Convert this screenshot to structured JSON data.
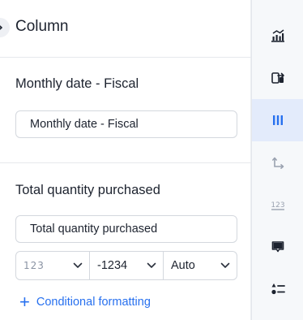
{
  "header": {
    "title": "Column"
  },
  "sections": [
    {
      "title": "Monthly date - Fiscal",
      "input_value": "Monthly date - Fiscal"
    },
    {
      "title": "Total quantity purchased",
      "input_value": "Total quantity purchased"
    }
  ],
  "format": {
    "number_format": "123",
    "negative_format": "-1234",
    "units": "Auto"
  },
  "conditional_link": {
    "label": "Conditional formatting"
  },
  "rail": {
    "items": [
      {
        "icon": "chart-icon",
        "active": false
      },
      {
        "icon": "swap-icon",
        "active": false
      },
      {
        "icon": "columns-icon",
        "active": true
      },
      {
        "icon": "axis-icon",
        "active": false
      },
      {
        "icon": "number-format-icon",
        "active": false
      },
      {
        "icon": "tooltip-icon",
        "active": false
      },
      {
        "icon": "settings-list-icon",
        "active": false
      }
    ],
    "accent_color": "#2770ef"
  }
}
